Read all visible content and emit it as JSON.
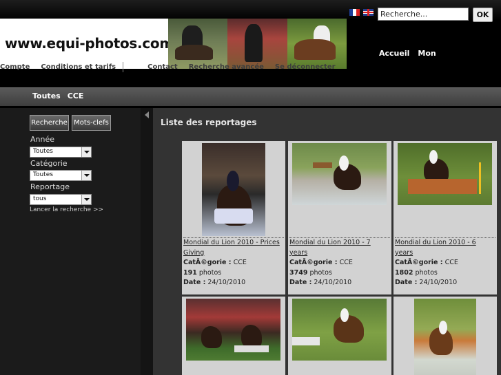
{
  "header": {
    "site_name": "www.equi-photos.com",
    "search_placeholder": "Recherche...",
    "ok_label": "OK",
    "languages": [
      "fr-flag-icon",
      "uk-flag-icon"
    ],
    "nav_right": [
      "Accueil",
      "Mon"
    ],
    "nav_left": [
      "Compte",
      "Conditions et tarifs",
      "Contact",
      "Recherche avancée",
      "Se déconnecter"
    ]
  },
  "subnav": {
    "items": [
      "Toutes",
      "CCE"
    ]
  },
  "sidebar": {
    "tab_search": "Recherche",
    "tab_keywords": "Mots-clefs",
    "year_label": "Année",
    "year_value": "Toutes",
    "category_label": "Catégorie",
    "category_value": "Toutes",
    "report_label": "Reportage",
    "report_value": "tous",
    "launch_link": "Lancer la recherche >>"
  },
  "main": {
    "title": "Liste des reportages",
    "cards": [
      {
        "title": "Mondial du Lion 2010 - Prices Giving",
        "category_label": "CatÃ©gorie :",
        "category": "CCE",
        "count": "191",
        "count_unit": "photos",
        "date_label": "Date :",
        "date": "24/10/2010"
      },
      {
        "title": "Mondial du Lion 2010 - 7 years",
        "category_label": "CatÃ©gorie :",
        "category": "CCE",
        "count": "3749",
        "count_unit": "photos",
        "date_label": "Date :",
        "date": "24/10/2010"
      },
      {
        "title": "Mondial du Lion 2010 - 6 years",
        "category_label": "CatÃ©gorie :",
        "category": "CCE",
        "count": "1802",
        "count_unit": "photos",
        "date_label": "Date :",
        "date": "24/10/2010"
      },
      {
        "title": "",
        "category_label": "",
        "category": "",
        "count": "",
        "count_unit": "",
        "date_label": "",
        "date": ""
      },
      {
        "title": "",
        "category_label": "",
        "category": "",
        "count": "",
        "count_unit": "",
        "date_label": "",
        "date": ""
      },
      {
        "title": "",
        "category_label": "",
        "category": "",
        "count": "",
        "count_unit": "",
        "date_label": "",
        "date": ""
      }
    ]
  },
  "colors": {
    "background": "#000000",
    "content_bg": "#333333",
    "card_bg": "#d2d2d2",
    "sidebar_bg": "#1b1b1b"
  }
}
